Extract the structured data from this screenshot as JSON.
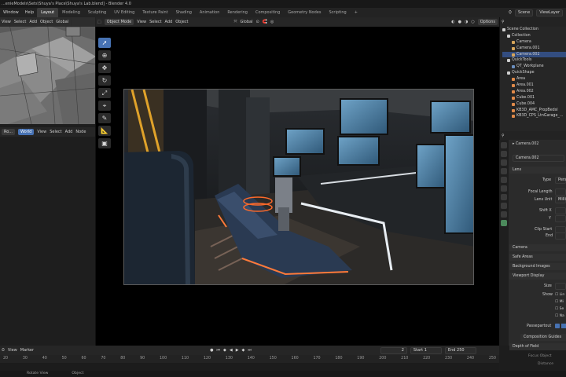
{
  "titlebar": {
    "text": "...enieModels\\Sets\\Shuya's Place\\Shuya's Lab.blend] - Blender 4.0"
  },
  "menubar": {
    "menus": [
      "Window",
      "Help"
    ],
    "workspaces": [
      "Layout",
      "Modeling",
      "Sculpting",
      "UV Editing",
      "Texture Paint",
      "Shading",
      "Animation",
      "Rendering",
      "Compositing",
      "Geometry Nodes",
      "Scripting",
      "+"
    ],
    "active_workspace": "Layout",
    "scene_label": "Scene",
    "view_layer_label": "ViewLayer"
  },
  "left_header": {
    "items": [
      "View",
      "Select",
      "Add",
      "Object"
    ],
    "orient": "Global"
  },
  "viewport_header": {
    "mode": "Object Mode",
    "menus": [
      "View",
      "Select",
      "Add",
      "Object"
    ],
    "orient": "Global",
    "options": "Options"
  },
  "node_header": {
    "items": [
      "Ro...",
      "World",
      "View",
      "Select",
      "Add",
      "Node"
    ]
  },
  "outliner": {
    "title": "Scene Collection",
    "rows": [
      {
        "label": "Collection",
        "color": "#cfcfcf",
        "sel": false
      },
      {
        "label": "Camera",
        "color": "#d6a55a",
        "sel": false
      },
      {
        "label": "Camera.001",
        "color": "#d6a55a",
        "sel": false
      },
      {
        "label": "Camera.002",
        "color": "#d6a55a",
        "sel": true
      },
      {
        "label": "QuickTools",
        "color": "#cfcfcf",
        "sel": false
      },
      {
        "label": "QT_Workplane",
        "color": "#6b8fbf",
        "sel": false
      },
      {
        "label": "QuickShape",
        "color": "#cfcfcf",
        "sel": false
      },
      {
        "label": "Area",
        "color": "#e08a4a",
        "sel": false
      },
      {
        "label": "Area.001",
        "color": "#e08a4a",
        "sel": false
      },
      {
        "label": "Area.002",
        "color": "#e08a4a",
        "sel": false
      },
      {
        "label": "Cube.001",
        "color": "#e08a4a",
        "sel": false
      },
      {
        "label": "Cube.004",
        "color": "#e08a4a",
        "sel": false
      },
      {
        "label": "KB3D_AMC_PropBedsl",
        "color": "#e08a4a",
        "sel": false
      },
      {
        "label": "KB3D_CPS_LtnGarage_...",
        "color": "#e08a4a",
        "sel": false
      }
    ]
  },
  "properties": {
    "object_name": "Camera.002",
    "data_name": "Camera.002",
    "sections": {
      "lens": "Lens",
      "type_label": "Type",
      "type_value": "Pers",
      "focal_length": "Focal Length",
      "lens_unit": "Lens Unit",
      "lens_unit_value": "Milli",
      "shift_x": "Shift X",
      "shift_y": "Y",
      "clip_start": "Clip Start",
      "clip_end": "End",
      "camera": "Camera",
      "safe_areas": "Safe Areas",
      "background_images": "Background Images",
      "viewport_display": "Viewport Display",
      "size": "Size",
      "show": "Show",
      "show_items": [
        "Lin",
        "Mi",
        "Se",
        "Na"
      ],
      "passepartout": "Passepartout",
      "composition_guides": "Composition Guides",
      "depth_of_field": "Depth of Field",
      "focus_object": "Focus Object",
      "distance": "Distance"
    }
  },
  "timeline": {
    "menus": [
      "View",
      "Marker"
    ],
    "current_frame": "2",
    "start_label": "Start",
    "start_value": "1",
    "end_label": "End",
    "end_value": "250",
    "ruler": [
      "20",
      "30",
      "40",
      "50",
      "60",
      "70",
      "80",
      "90",
      "100",
      "110",
      "120",
      "130",
      "140",
      "150",
      "160",
      "170",
      "180",
      "190",
      "200",
      "210",
      "220",
      "230",
      "240",
      "250"
    ]
  },
  "statusbar": {
    "items": [
      "Rotate View",
      "Object"
    ]
  }
}
